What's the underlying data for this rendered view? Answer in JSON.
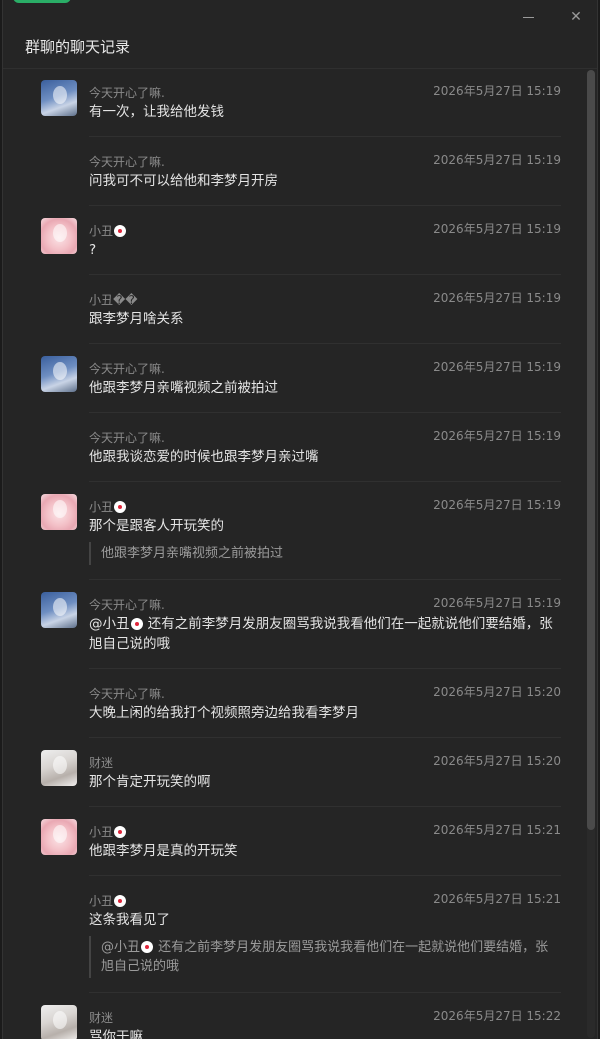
{
  "window": {
    "title": "群聊的聊天记录",
    "minimize_icon": "minimize-icon",
    "close_icon": "close-icon",
    "close_glyph": "✕"
  },
  "messages": [
    {
      "name": "今天开心了嘛.",
      "time": "2026年5月27日 15:19",
      "text": "有一次，让我给他发钱",
      "avatar": "blue",
      "show_avatar": true
    },
    {
      "name": "今天开心了嘛.",
      "time": "2026年5月27日 15:19",
      "text": "问我可不可以给他和李梦月开房",
      "avatar": "blue",
      "show_avatar": false
    },
    {
      "name": "小丑",
      "name_emoji": true,
      "time": "2026年5月27日 15:19",
      "text": "?",
      "avatar": "pink",
      "show_avatar": true
    },
    {
      "name": "小丑��",
      "time": "2026年5月27日 15:19",
      "text": "跟李梦月啥关系",
      "avatar": "pink",
      "show_avatar": false
    },
    {
      "name": "今天开心了嘛.",
      "time": "2026年5月27日 15:19",
      "text": "他跟李梦月亲嘴视频之前被拍过",
      "avatar": "blue",
      "show_avatar": true
    },
    {
      "name": "今天开心了嘛.",
      "time": "2026年5月27日 15:19",
      "text": "他跟我谈恋爱的时候也跟李梦月亲过嘴",
      "avatar": "blue",
      "show_avatar": false
    },
    {
      "name": "小丑",
      "name_emoji": true,
      "time": "2026年5月27日 15:19",
      "text": "那个是跟客人开玩笑的",
      "quote": "他跟李梦月亲嘴视频之前被拍过",
      "avatar": "pink",
      "show_avatar": true
    },
    {
      "name": "今天开心了嘛.",
      "time": "2026年5月27日 15:19",
      "mention": "@小丑",
      "text": " 还有之前李梦月发朋友圈骂我说我看他们在一起就说他们要结婚，张旭自己说的哦",
      "avatar": "blue",
      "show_avatar": true
    },
    {
      "name": "今天开心了嘛.",
      "time": "2026年5月27日 15:20",
      "text": "大晚上闲的给我打个视频照旁边给我看李梦月",
      "avatar": "blue",
      "show_avatar": false
    },
    {
      "name": "财迷",
      "time": "2026年5月27日 15:20",
      "text": "那个肯定开玩笑的啊",
      "avatar": "gray",
      "show_avatar": true
    },
    {
      "name": "小丑",
      "name_emoji": true,
      "time": "2026年5月27日 15:21",
      "text": "他跟李梦月是真的开玩笑",
      "avatar": "pink",
      "show_avatar": true
    },
    {
      "name": "小丑",
      "name_emoji": true,
      "time": "2026年5月27日 15:21",
      "text": "这条我看见了",
      "quote_mention": "@小丑",
      "quote": " 还有之前李梦月发朋友圈骂我说我看他们在一起就说他们要结婚，张旭自己说的哦",
      "avatar": "pink",
      "show_avatar": false
    },
    {
      "name": "财迷",
      "time": "2026年5月27日 15:22",
      "text": "骂你干嘛",
      "avatar": "gray",
      "show_avatar": true
    }
  ]
}
